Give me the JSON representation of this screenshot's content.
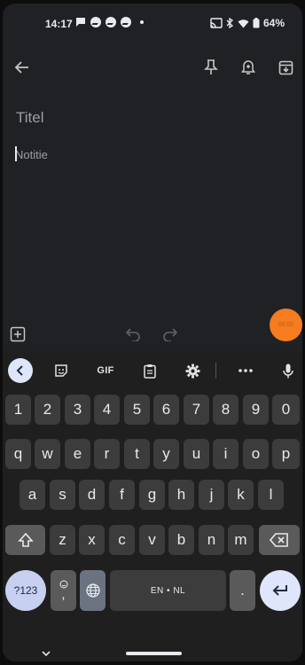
{
  "status_bar": {
    "time": "14:17",
    "battery": "64%"
  },
  "note": {
    "title_placeholder": "Titel",
    "body_placeholder": "Notitie"
  },
  "fab": {
    "label": "00:00"
  },
  "keyboard": {
    "gif_label": "GIF",
    "row_numbers": [
      "1",
      "2",
      "3",
      "4",
      "5",
      "6",
      "7",
      "8",
      "9",
      "0"
    ],
    "row1": [
      "q",
      "w",
      "e",
      "r",
      "t",
      "y",
      "u",
      "i",
      "o",
      "p"
    ],
    "row2": [
      "a",
      "s",
      "d",
      "f",
      "g",
      "h",
      "j",
      "k",
      "l"
    ],
    "row3": [
      "z",
      "x",
      "c",
      "v",
      "b",
      "n",
      "m"
    ],
    "symbols_label": "?123",
    "comma": ",",
    "space_label": "EN • NL",
    "period": ".",
    "colors": {
      "accent": "#c7d0f0",
      "fab": "#f57c1f"
    }
  }
}
